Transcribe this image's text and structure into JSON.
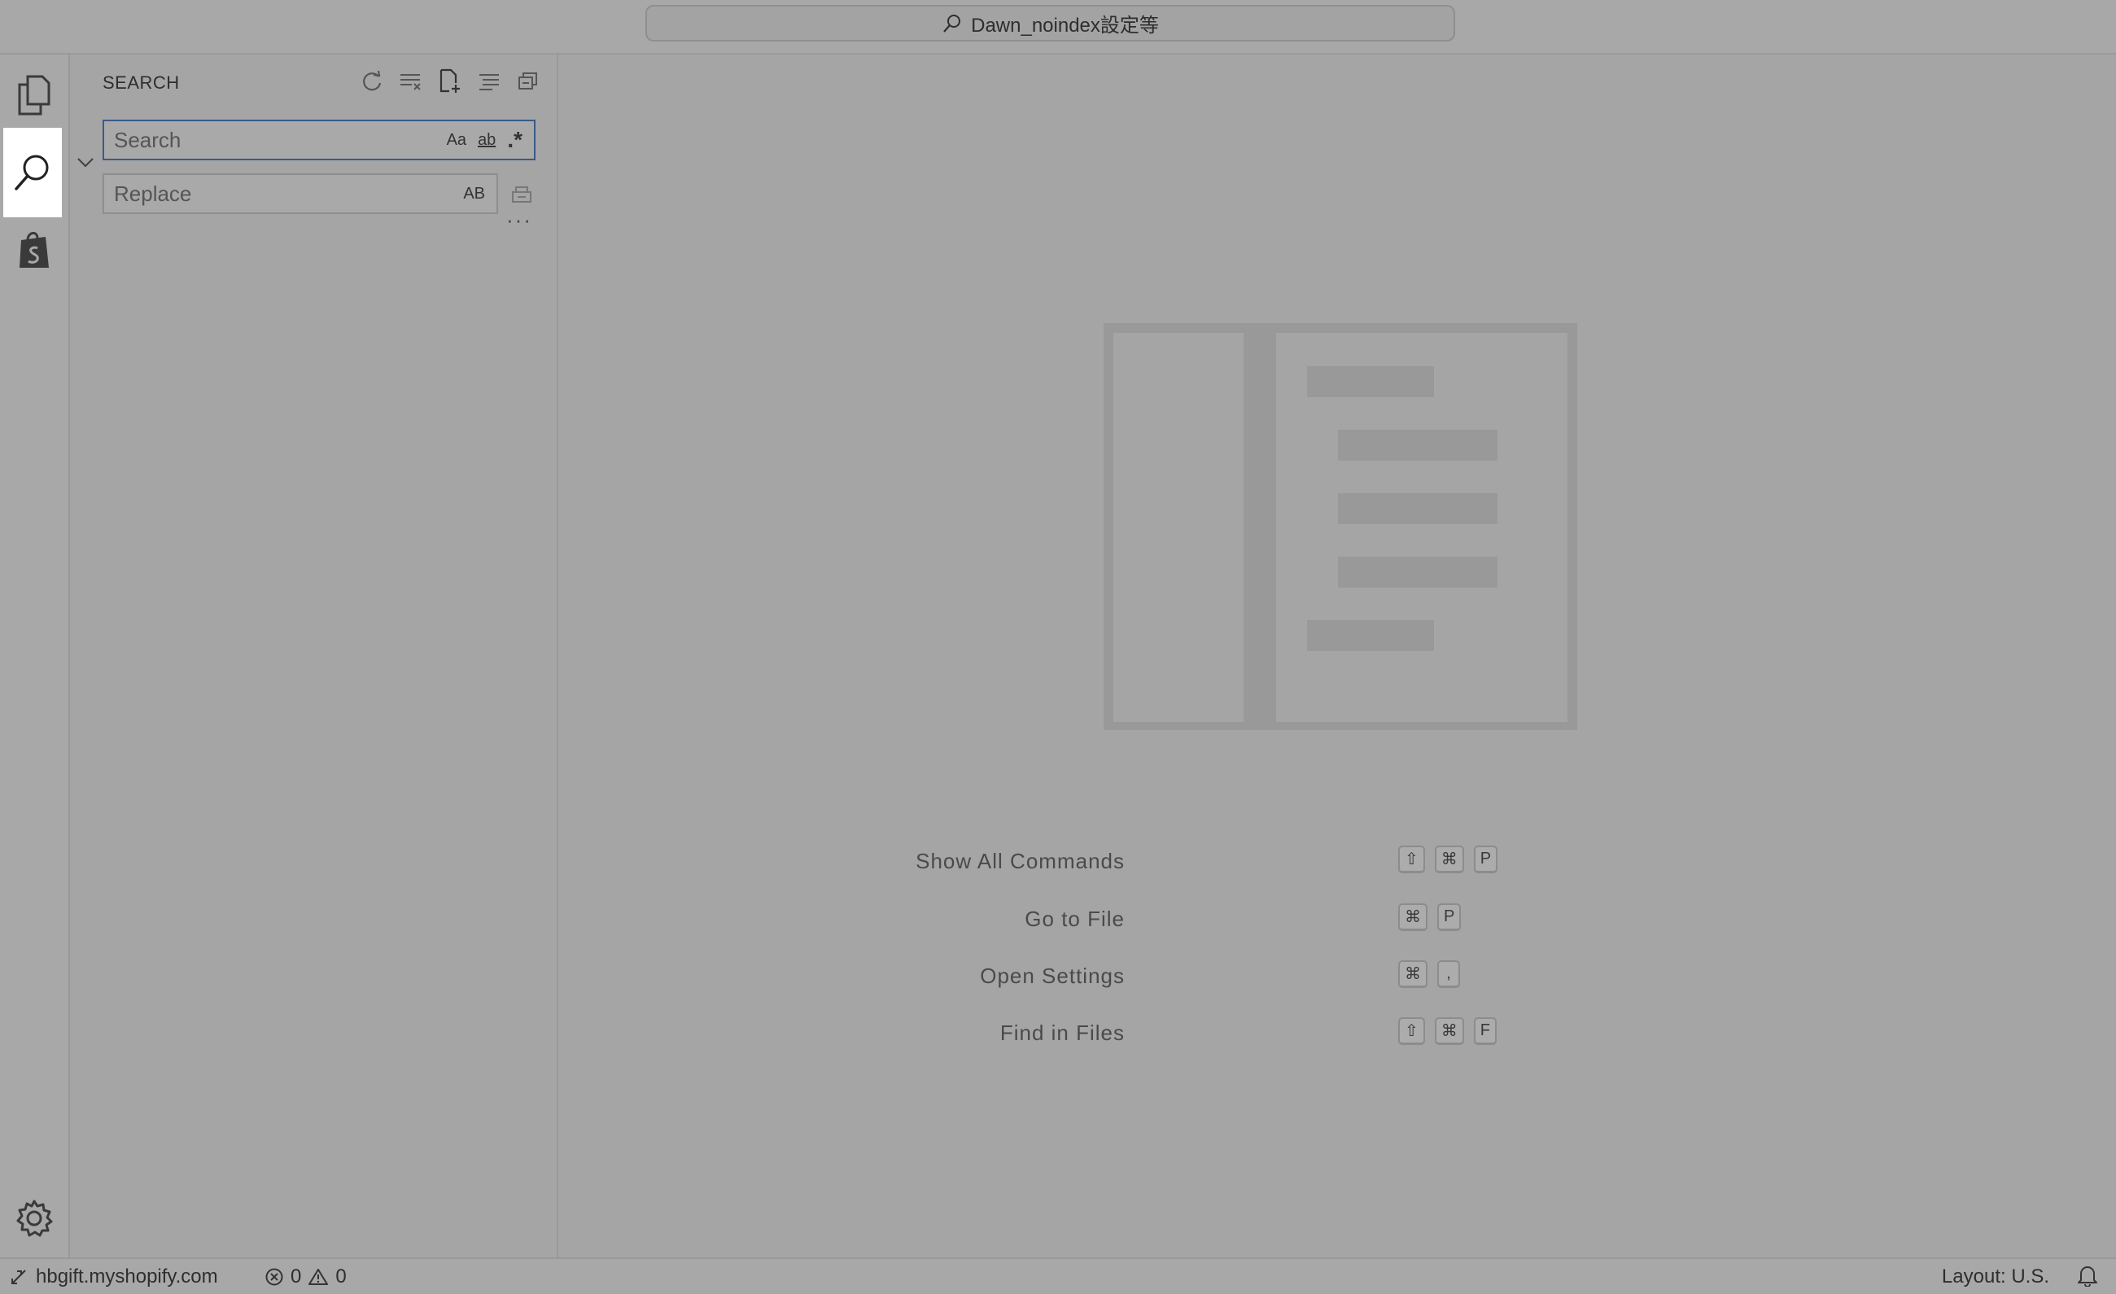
{
  "titlebar": {
    "search_text": "Dawn_noindex設定等"
  },
  "activitybar": {
    "items": [
      {
        "name": "explorer-icon"
      },
      {
        "name": "search-icon",
        "active": true
      },
      {
        "name": "shopify-icon"
      }
    ],
    "manage": {
      "name": "gear-icon"
    }
  },
  "sidebar": {
    "title": "SEARCH",
    "actions": [
      "refresh-icon",
      "clear-results-icon",
      "new-search-editor-icon",
      "view-as-tree-icon",
      "collapse-all-icon"
    ],
    "search": {
      "placeholder": "Search",
      "value": "",
      "match_case": "Aa",
      "whole_word": "ab",
      "regex": ".*"
    },
    "replace": {
      "placeholder": "Replace",
      "value": "",
      "preserve_case": "AB"
    },
    "more": "···"
  },
  "editor": {
    "shortcuts": [
      {
        "label": "Show All Commands",
        "keys": [
          "⇧",
          "⌘",
          "P"
        ]
      },
      {
        "label": "Go to File",
        "keys": [
          "⌘",
          "P"
        ]
      },
      {
        "label": "Open Settings",
        "keys": [
          "⌘",
          ","
        ]
      },
      {
        "label": "Find in Files",
        "keys": [
          "⇧",
          "⌘",
          "F"
        ]
      }
    ]
  },
  "statusbar": {
    "remote": "hbgift.myshopify.com",
    "errors": "0",
    "warnings": "0",
    "layout": "Layout: U.S."
  },
  "colors": {
    "accent_border": "#3a5a8a",
    "active_bg": "#ffffff"
  }
}
